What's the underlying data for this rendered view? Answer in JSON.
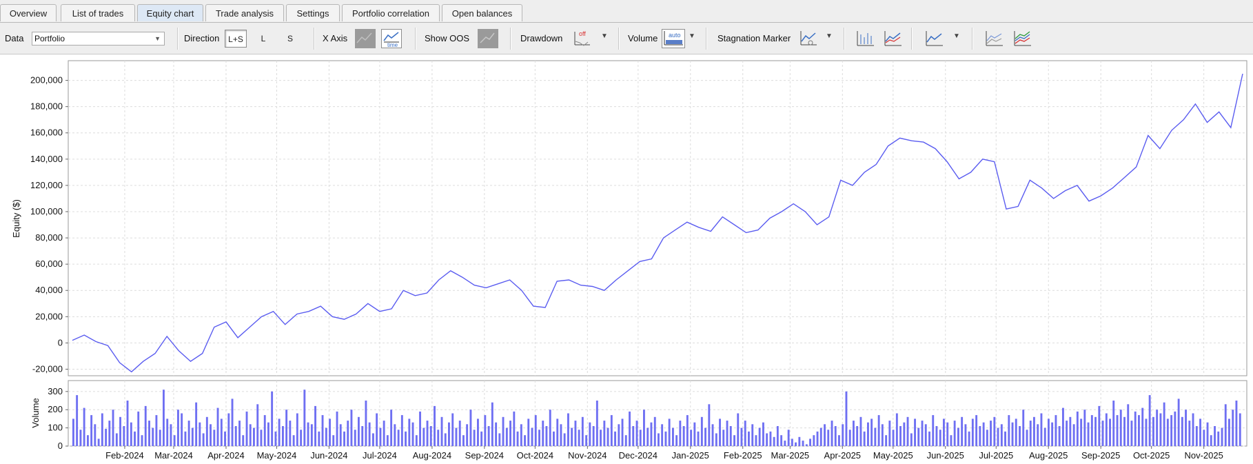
{
  "tabs": [
    {
      "label": "Overview",
      "active": false
    },
    {
      "label": "List of trades",
      "active": false
    },
    {
      "label": "Equity chart",
      "active": true
    },
    {
      "label": "Trade analysis",
      "active": false
    },
    {
      "label": "Settings",
      "active": false
    },
    {
      "label": "Portfolio correlation",
      "active": false
    },
    {
      "label": "Open balances",
      "active": false
    }
  ],
  "toolbar": {
    "data_label": "Data",
    "data_value": "Portfolio",
    "direction_label": "Direction",
    "direction_options": [
      "L+S",
      "L",
      "S"
    ],
    "direction_selected": "L+S",
    "xaxis_label": "X Axis",
    "xaxis_selected": "time",
    "time_icon_text": "time",
    "show_oos_label": "Show OOS",
    "drawdown_label": "Drawdown",
    "drawdown_icon_text": "off",
    "volume_label": "Volume",
    "volume_icon_text": "auto",
    "stagnation_label": "Stagnation Marker",
    "icons": [
      "chart-bars-icon",
      "chart-line-compare-icon",
      "chart-line-icon",
      "chart-multi-line-icon",
      "chart-colored-lines-icon"
    ],
    "accent_color": "#3a6fc4"
  },
  "chart_data": [
    {
      "type": "line",
      "title": "",
      "xlabel": "",
      "ylabel": "Equity ($)",
      "ylim": [
        -25000,
        215000
      ],
      "y_ticks": [
        200000,
        180000,
        160000,
        140000,
        120000,
        100000,
        80000,
        60000,
        40000,
        20000,
        0,
        -20000
      ],
      "y_tick_labels": [
        "200,000",
        "180,000",
        "160,000",
        "140,000",
        "120,000",
        "100,000",
        "80,000",
        "60,000",
        "40,000",
        "20,000",
        "0",
        "-20,000"
      ],
      "x_tick_labels": [
        "Feb-2024",
        "Mar-2024",
        "Apr-2024",
        "May-2024",
        "Jun-2024",
        "Jul-2024",
        "Aug-2024",
        "Sep-2024",
        "Oct-2024",
        "Nov-2024",
        "Dec-2024",
        "Jan-2025",
        "Feb-2025",
        "Mar-2025",
        "Apr-2025",
        "May-2025",
        "Jun-2025",
        "Jul-2025",
        "Aug-2025",
        "Sep-2025",
        "Oct-2025",
        "Nov-2025"
      ],
      "x_range": [
        "2024-01-01",
        "2025-11-24"
      ],
      "grid": true,
      "line_color": "#5a5cf0",
      "series": [
        {
          "x": [
            "2024-01-01",
            "2024-01-08",
            "2024-01-15",
            "2024-01-22",
            "2024-01-29",
            "2024-02-05",
            "2024-02-12",
            "2024-02-19",
            "2024-02-26",
            "2024-03-04",
            "2024-03-11",
            "2024-03-18",
            "2024-03-25",
            "2024-04-01",
            "2024-04-08",
            "2024-04-15",
            "2024-04-22",
            "2024-04-29",
            "2024-05-06",
            "2024-05-13",
            "2024-05-20",
            "2024-05-27",
            "2024-06-03",
            "2024-06-10",
            "2024-06-17",
            "2024-06-24",
            "2024-07-01",
            "2024-07-08",
            "2024-07-15",
            "2024-07-22",
            "2024-07-29",
            "2024-08-05",
            "2024-08-12",
            "2024-08-19",
            "2024-08-26",
            "2024-09-02",
            "2024-09-09",
            "2024-09-16",
            "2024-09-23",
            "2024-09-30",
            "2024-10-07",
            "2024-10-14",
            "2024-10-21",
            "2024-10-28",
            "2024-11-04",
            "2024-11-11",
            "2024-11-18",
            "2024-11-25",
            "2024-12-02",
            "2024-12-09",
            "2024-12-16",
            "2024-12-23",
            "2024-12-30",
            "2025-01-06",
            "2025-01-13",
            "2025-01-20",
            "2025-01-27",
            "2025-02-03",
            "2025-02-10",
            "2025-02-17",
            "2025-02-24",
            "2025-03-03",
            "2025-03-10",
            "2025-03-17",
            "2025-03-24",
            "2025-03-31",
            "2025-04-07",
            "2025-04-14",
            "2025-04-21",
            "2025-04-28",
            "2025-05-05",
            "2025-05-12",
            "2025-05-19",
            "2025-05-26",
            "2025-06-02",
            "2025-06-09",
            "2025-06-16",
            "2025-06-23",
            "2025-06-30",
            "2025-07-07",
            "2025-07-14",
            "2025-07-21",
            "2025-07-28",
            "2025-08-04",
            "2025-08-11",
            "2025-08-18",
            "2025-08-25",
            "2025-09-01",
            "2025-09-08",
            "2025-09-15",
            "2025-09-22",
            "2025-09-29",
            "2025-10-06",
            "2025-10-13",
            "2025-10-20",
            "2025-10-27",
            "2025-11-03",
            "2025-11-10",
            "2025-11-17",
            "2025-11-24"
          ],
          "y": [
            2000,
            6000,
            1000,
            -2000,
            -15000,
            -22000,
            -14000,
            -8000,
            5000,
            -6000,
            -14000,
            -8000,
            12000,
            16000,
            4000,
            12000,
            20000,
            24000,
            14000,
            22000,
            24000,
            28000,
            20000,
            18000,
            22000,
            30000,
            24000,
            26000,
            40000,
            36000,
            38000,
            48000,
            55000,
            50000,
            44000,
            42000,
            45000,
            48000,
            40000,
            28000,
            27000,
            47000,
            48000,
            44000,
            43000,
            40000,
            48000,
            55000,
            62000,
            64000,
            80000,
            86000,
            92000,
            88000,
            85000,
            96000,
            90000,
            84000,
            86000,
            95000,
            100000,
            106000,
            100000,
            90000,
            96000,
            124000,
            120000,
            130000,
            136000,
            150000,
            156000,
            154000,
            153000,
            148000,
            138000,
            125000,
            130000,
            140000,
            138000,
            102000,
            104000,
            124000,
            118000,
            110000,
            116000,
            120000,
            108000,
            112000,
            118000,
            126000,
            134000,
            158000,
            148000,
            162000,
            170000,
            182000,
            168000,
            176000,
            164000,
            205000
          ]
        }
      ]
    },
    {
      "type": "bar",
      "title": "",
      "xlabel": "",
      "ylabel": "Volume",
      "ylim": [
        0,
        360
      ],
      "y_ticks": [
        0,
        100,
        200,
        300
      ],
      "y_tick_labels": [
        "0",
        "100",
        "200",
        "300"
      ],
      "bar_color": "#6e6ff2",
      "values": [
        150,
        280,
        90,
        210,
        60,
        170,
        120,
        40,
        180,
        95,
        140,
        200,
        70,
        160,
        110,
        250,
        130,
        80,
        190,
        60,
        220,
        140,
        100,
        170,
        90,
        310,
        150,
        120,
        60,
        200,
        180,
        80,
        140,
        100,
        240,
        130,
        70,
        160,
        120,
        90,
        210,
        150,
        80,
        180,
        260,
        110,
        140,
        60,
        190,
        120,
        100,
        230,
        90,
        170,
        130,
        300,
        80,
        150,
        110,
        200,
        140,
        60,
        180,
        90,
        310,
        130,
        120,
        220,
        80,
        170,
        100,
        150,
        60,
        190,
        120,
        80,
        140,
        200,
        90,
        160,
        110,
        250,
        130,
        70,
        180,
        100,
        140,
        60,
        200,
        120,
        90,
        170,
        80,
        150,
        130,
        60,
        190,
        100,
        140,
        110,
        220,
        90,
        160,
        70,
        130,
        180,
        100,
        140,
        60,
        120,
        200,
        90,
        150,
        80,
        170,
        110,
        240,
        130,
        70,
        160,
        100,
        140,
        190,
        80,
        120,
        60,
        150,
        100,
        170,
        90,
        140,
        110,
        200,
        80,
        150,
        120,
        70,
        180,
        100,
        140,
        90,
        160,
        60,
        130,
        110,
        250,
        90,
        140,
        100,
        170,
        80,
        120,
        150,
        60,
        190,
        110,
        140,
        90,
        200,
        100,
        130,
        160,
        70,
        120,
        80,
        150,
        100,
        60,
        140,
        110,
        170,
        90,
        130,
        80,
        160,
        100,
        230,
        120,
        70,
        150,
        90,
        140,
        110,
        60,
        180,
        100,
        140,
        80,
        120,
        60,
        100,
        130,
        70,
        80,
        50,
        110,
        60,
        30,
        90,
        40,
        20,
        50,
        30,
        10,
        40,
        60,
        80,
        100,
        120,
        90,
        140,
        110,
        60,
        120,
        300,
        90,
        140,
        110,
        160,
        80,
        130,
        150,
        100,
        170,
        120,
        60,
        140,
        90,
        180,
        110,
        130,
        160,
        70,
        150,
        100,
        140,
        120,
        80,
        170,
        110,
        90,
        150,
        130,
        60,
        140,
        100,
        160,
        120,
        80,
        150,
        170,
        110,
        130,
        90,
        140,
        160,
        100,
        120,
        80,
        170,
        130,
        150,
        110,
        200,
        90,
        140,
        160,
        120,
        180,
        100,
        150,
        130,
        170,
        110,
        210,
        140,
        160,
        120,
        190,
        150,
        200,
        130,
        170,
        160,
        220,
        140,
        180,
        150,
        250,
        170,
        200,
        160,
        230,
        140,
        190,
        170,
        210,
        150,
        280,
        160,
        200,
        180,
        240,
        150,
        170,
        190,
        260,
        160,
        200,
        140,
        180,
        110,
        150,
        90,
        130,
        60,
        110,
        80,
        100,
        230,
        150,
        200,
        250,
        180
      ]
    }
  ]
}
